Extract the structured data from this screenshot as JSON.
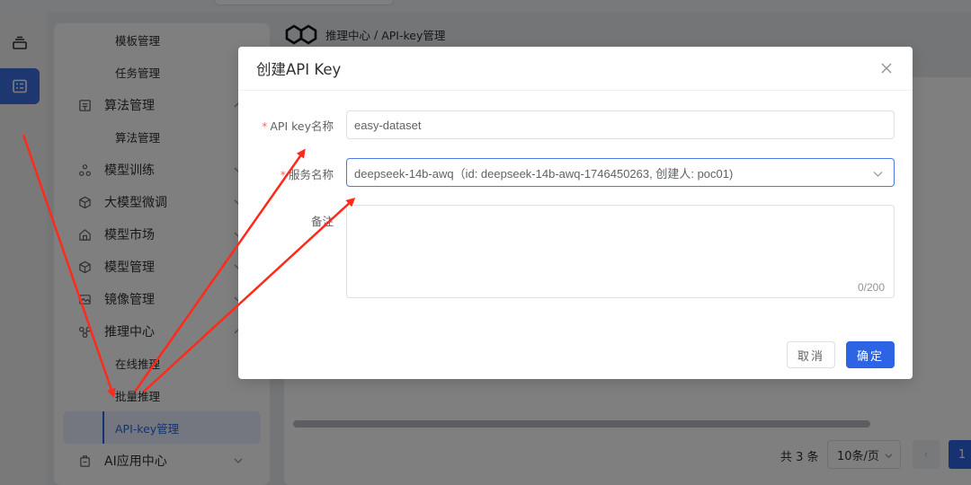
{
  "breadcrumb": {
    "parent": "推理中心",
    "separator": " / ",
    "current": "API-key管理"
  },
  "sidebar": {
    "items": [
      {
        "type": "sub",
        "label": "模板管理"
      },
      {
        "type": "sub",
        "label": "任务管理"
      },
      {
        "type": "group",
        "label": "算法管理",
        "icon": "algorithm-icon"
      },
      {
        "type": "sub",
        "label": "算法管理"
      },
      {
        "type": "group",
        "label": "模型训练",
        "icon": "training-icon"
      },
      {
        "type": "group",
        "label": "大模型微调",
        "icon": "cube-icon"
      },
      {
        "type": "group",
        "label": "模型市场",
        "icon": "store-icon"
      },
      {
        "type": "group",
        "label": "模型管理",
        "icon": "cube-icon"
      },
      {
        "type": "group",
        "label": "镜像管理",
        "icon": "image-icon"
      },
      {
        "type": "group",
        "label": "推理中心",
        "icon": "inference-icon"
      },
      {
        "type": "sub",
        "label": "在线推理"
      },
      {
        "type": "sub",
        "label": "批量推理"
      },
      {
        "type": "sub",
        "label": "API-key管理",
        "active": true
      },
      {
        "type": "group",
        "label": "AI应用中心",
        "icon": "app-icon"
      }
    ]
  },
  "pagination": {
    "total": "共 3 条",
    "page_size": "10条/页",
    "page": "1"
  },
  "modal": {
    "title": "创建API Key",
    "fields": {
      "name": {
        "required_mark": "*",
        "label": "API key名称",
        "value": "easy-dataset"
      },
      "service": {
        "required_mark": "*",
        "label": "服务名称",
        "value": "deepseek-14b-awq（id: deepseek-14b-awq-1746450263, 创建人: poc01)"
      },
      "remark": {
        "label": "备注",
        "value": "",
        "counter": "0/200"
      }
    },
    "cancel_label": "取消",
    "confirm_label": "确定"
  },
  "colors": {
    "primary": "#2d64e3",
    "annotation_arrow": "#ff2a1a",
    "required": "#f56c6c"
  }
}
